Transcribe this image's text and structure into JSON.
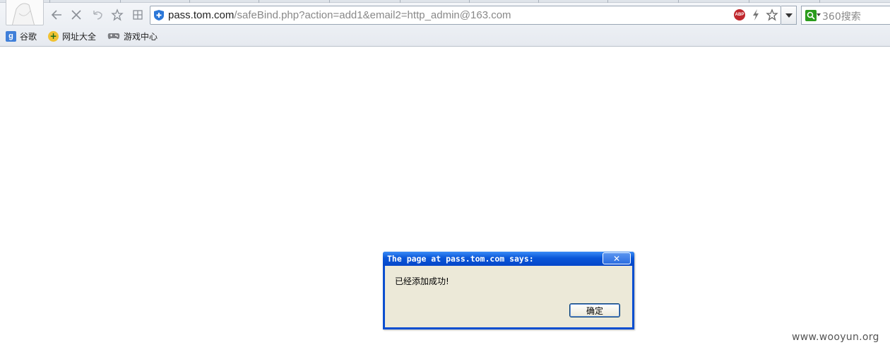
{
  "browser": {
    "address_bar": {
      "url_host": "pass.tom.com",
      "url_path": "/safeBind.php?action=add1&email2=http_admin@163.com"
    },
    "adblock_label": "ABP",
    "search": {
      "placeholder": "360搜索"
    },
    "bookmarks": [
      {
        "label": "谷歌",
        "icon": "google-icon"
      },
      {
        "label": "网址大全",
        "icon": "web-directory-icon"
      },
      {
        "label": "游戏中心",
        "icon": "gamepad-icon"
      }
    ]
  },
  "dialog": {
    "title": "The page at pass.tom.com says:",
    "close_label": "✕",
    "message": "已经添加成功!",
    "ok_label": "确定"
  },
  "watermark": "www.wooyun.org",
  "colors": {
    "dialog_titlebar": "#0a56d8",
    "dialog_body": "#ece9d8",
    "search_logo": "#2a9c1c",
    "adblock": "#c0272d"
  }
}
